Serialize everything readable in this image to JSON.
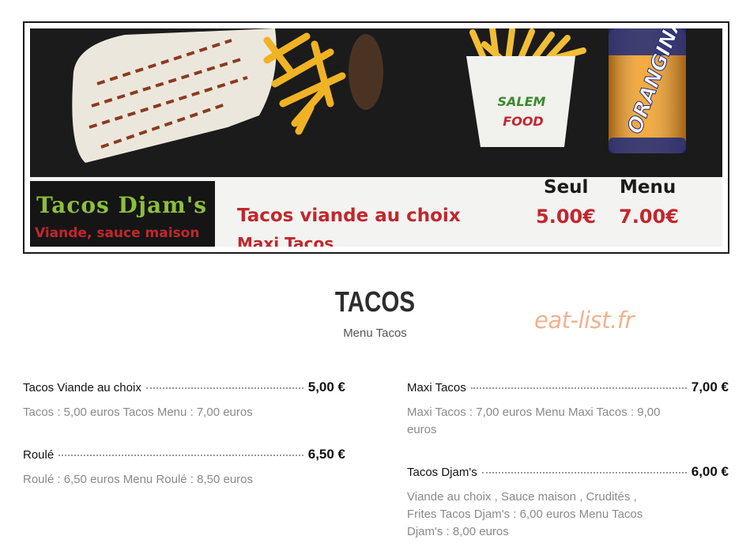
{
  "banner": {
    "fries_box_line1": "SALEM",
    "fries_box_line2": "FOOD",
    "can_text": "ORANGINA",
    "board_brand_title": "Tacos Djam's",
    "board_brand_sub": "Viande, sauce maison",
    "board_col_single": "Seul",
    "board_col_menu": "Menu",
    "board_item": "Tacos viande au choix",
    "board_item_2": "Maxi Tacos",
    "board_price_single": "5.00€",
    "board_price_menu": "7.00€"
  },
  "section": {
    "title": "TACOS",
    "subtitle": "Menu Tacos",
    "watermark": "eat-list.fr"
  },
  "items": [
    {
      "name": "Tacos Viande au choix",
      "price": "5,00 €",
      "description": "Tacos : 5,00 euros Tacos Menu : 7,00 euros"
    },
    {
      "name": "Roulé",
      "price": "6,50 €",
      "description": "Roulé : 6,50 euros Menu Roulé : 8,50 euros"
    },
    {
      "name": "Maxi Tacos",
      "price": "7,00 €",
      "description": "Maxi Tacos : 7,00 euros Menu Maxi Tacos : 9,00 euros"
    },
    {
      "name": "Tacos Djam's",
      "price": "6,00 €",
      "description": "Viande au choix , Sauce maison , Crudités , Frites Tacos Djam's : 6,00 euros Menu Tacos Djam's : 8,00 euros"
    }
  ],
  "colors": {
    "watermark": "#f2b28f",
    "board_red": "#c0272d",
    "board_green": "#8dbf3a"
  }
}
